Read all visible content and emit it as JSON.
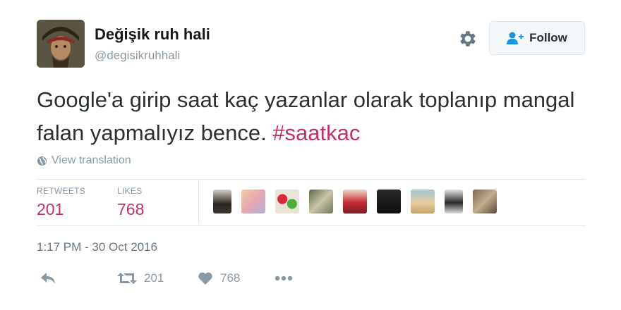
{
  "user": {
    "display_name": "Değişik ruh hali",
    "handle": "@degisikruhhali"
  },
  "follow_button": {
    "label": "Follow"
  },
  "tweet": {
    "text": "Google'a girip saat kaç yazanlar olarak toplanıp mangal falan yapmalıyız bence.",
    "hashtag": "#saatkac"
  },
  "translation_link": "View translation",
  "stats": {
    "retweets_label": "RETWEETS",
    "retweets": "201",
    "likes_label": "LIKES",
    "likes": "768"
  },
  "timestamp": "1:17 PM - 30 Oct 2016",
  "actions": {
    "retweet_count": "201",
    "like_count": "768"
  },
  "colors": {
    "accent": "#c0306b",
    "muted": "#8899a6"
  },
  "icons": [
    "gear-icon",
    "follow-user-icon",
    "globe-icon",
    "reply-icon",
    "retweet-icon",
    "heart-icon",
    "more-icon"
  ]
}
